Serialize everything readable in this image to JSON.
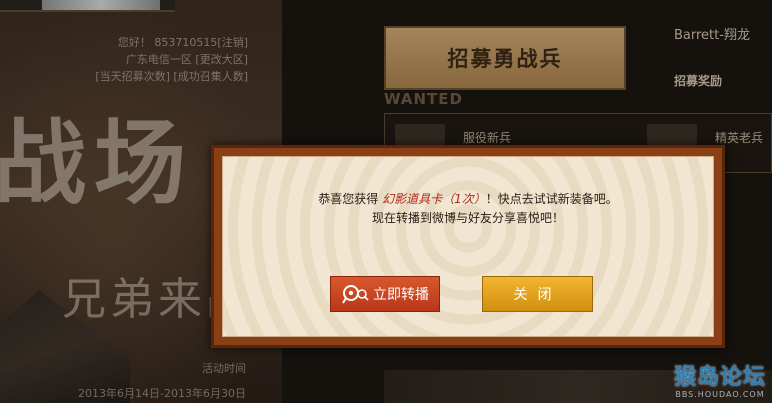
{
  "left": {
    "greeting": "您好！ 853710515[注销]",
    "region": "广东电信一区 [更改大区]",
    "links": "[当天招募次数] [成功召集人数]",
    "big_title": "战场",
    "sub_title": "兄弟来战",
    "event_label": "活动时间",
    "event_dates": "2013年6月14日-2013年6月30日"
  },
  "right": {
    "recruit_button": "招募勇战兵",
    "player_name": "Barrett-翔龙",
    "reward_link": "招募奖励",
    "wanted_label": "WANTED",
    "slots": [
      {
        "label": "服役新兵"
      },
      {
        "label": "精英老兵"
      }
    ]
  },
  "dialog": {
    "line1_prefix": "恭喜您获得",
    "item_name": "幻影道具卡（1次）",
    "line1_suffix": "！快点去试试新装备吧。",
    "line2": "现在转播到微博与好友分享喜悦吧！",
    "share_button": "立即转播",
    "close_button": "关闭"
  },
  "watermark": {
    "name": "猴岛论坛",
    "url": "BBS.HOUDAO.COM"
  },
  "colors": {
    "dialog_frame": "#8a3f16",
    "share_button": "#c8461f",
    "close_button": "#e2a31f",
    "item_highlight": "#b0281a"
  }
}
